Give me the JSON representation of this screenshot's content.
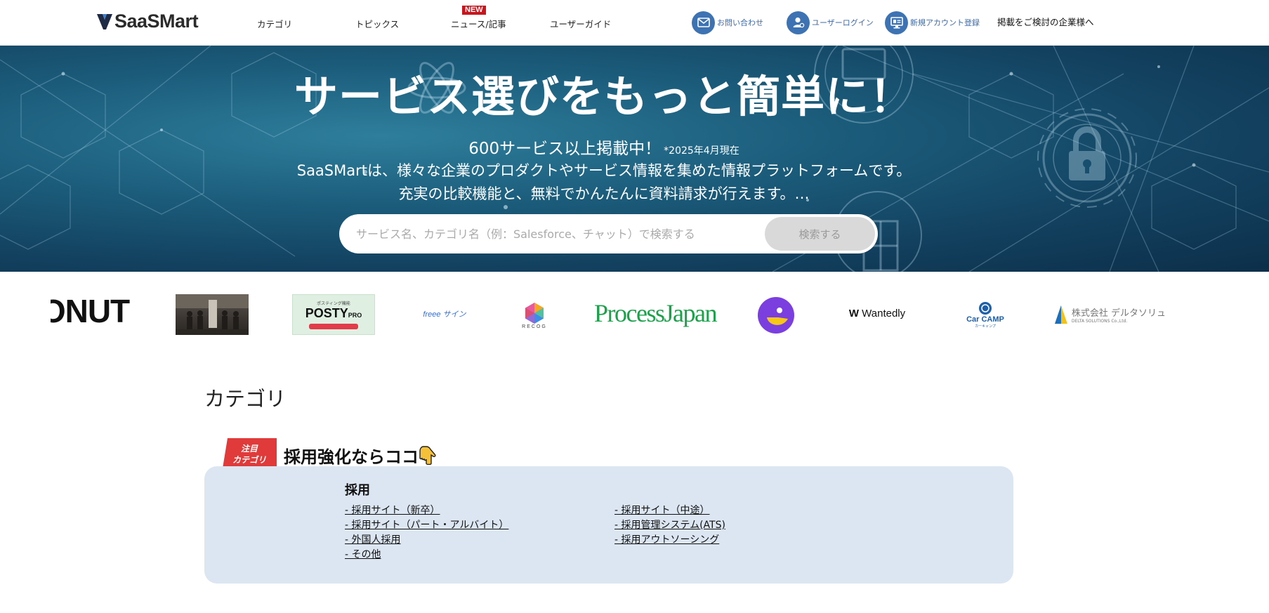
{
  "header": {
    "logo_text": "SaaSMart",
    "nav": [
      "カテゴリ",
      "トピックス",
      "ニュース/記事",
      "ユーザーガイド"
    ],
    "new_badge": "NEW",
    "contact_label": "お問い合わせ",
    "login_label": "ユーザーログイン",
    "signup_label": "新規アカウント登録",
    "advertise_label": "掲載をご検討の企業様へ"
  },
  "hero": {
    "title": "サービス選びをもっと簡単に！",
    "count_line": "600サービス以上掲載中！",
    "count_note": "*2025年4月現在",
    "desc_line1": "SaaSMartは、様々な企業のプロダクトやサービス情報を集めた情報プラットフォームです。",
    "desc_line2": "充実の比較機能と、無料でかんたんに資料請求が行えます。…",
    "search_placeholder": "サービス名、カテゴリ名（例：Salesforce、チャット）で検索する",
    "search_button": "検索する"
  },
  "logos": {
    "donut": "ONUT",
    "posty_top": "ポスティング機能",
    "posty": "POSTY",
    "posty_pro": "PRO",
    "freee": "freee サイン",
    "recog": "RECOG",
    "process_japan": "ProcessJapan",
    "wantedly": "Wantedly",
    "carcamp": "Car CAMP",
    "carcamp_sub": "カーキャンプ",
    "delta_company": "株式会社 デルタソリュ",
    "delta_en": "DELTA SOLUTIONS Co.,Ltd."
  },
  "category": {
    "section_title": "カテゴリ",
    "ribbon_line1": "注目",
    "ribbon_line2": "カテゴリ",
    "feature_title": "採用強化ならココ",
    "group_title": "採用",
    "links_left": [
      "- 採用サイト（新卒）",
      "- 採用サイト（パート・アルバイト）",
      "- 外国人採用",
      "- その他"
    ],
    "links_right": [
      "- 採用サイト（中途）",
      "- 採用管理システム(ATS)",
      "- 採用アウトソーシング"
    ]
  },
  "colors": {
    "accent_blue": "#3d73b2",
    "ribbon_red": "#e03a3a",
    "card_bg": "#dbe6f2",
    "new_badge": "#c7161d"
  }
}
